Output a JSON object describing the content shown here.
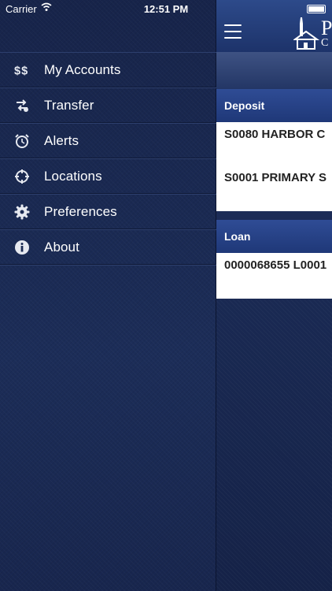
{
  "status_bar": {
    "carrier": "Carrier",
    "time": "12:51 PM"
  },
  "menu": {
    "items": [
      {
        "label": "My Accounts",
        "icon": "dollar-icon"
      },
      {
        "label": "Transfer",
        "icon": "transfer-icon"
      },
      {
        "label": "Alerts",
        "icon": "alarm-clock-icon"
      },
      {
        "label": "Locations",
        "icon": "crosshair-icon"
      },
      {
        "label": "Preferences",
        "icon": "gear-icon"
      },
      {
        "label": "About",
        "icon": "info-icon"
      }
    ]
  },
  "logo": {
    "line1": "P",
    "line2": "C"
  },
  "main": {
    "deposit_header": "Deposit",
    "deposit_accounts": [
      "S0080 HARBOR C",
      "S0001 PRIMARY S"
    ],
    "loan_header": "Loan",
    "loan_accounts": [
      "0000068655 L0001"
    ]
  },
  "colors": {
    "sidebar_bg": "#1a2a52",
    "header_blue": "#2f4c95",
    "card_bg": "#ffffff"
  }
}
